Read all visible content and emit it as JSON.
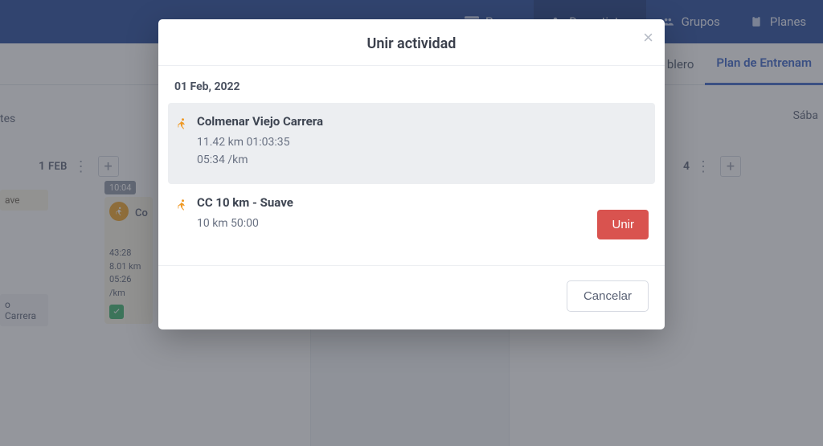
{
  "nav": {
    "items": [
      {
        "label": "Pagos",
        "icon": "pagos"
      },
      {
        "label": "Deportistas",
        "icon": "deportistas"
      },
      {
        "label": "Grupos",
        "icon": "grupos"
      },
      {
        "label": "Planes",
        "icon": "planes"
      }
    ],
    "active_index": 1
  },
  "subnav": {
    "items": [
      {
        "label": "blero"
      },
      {
        "label": "Plan de Entrenam"
      }
    ],
    "active_index": 1
  },
  "calendar": {
    "left_trunc_label": "tes",
    "right_trunc_label": "Sába",
    "day_feb1": {
      "num": "1",
      "month": "FEB"
    },
    "day_right": {
      "num": "4"
    },
    "bg_card1_title": "ave",
    "bg_card2_title": "o Carrera",
    "mini": {
      "time_badge": "10:04",
      "label_trunc": "Co",
      "line1": "43:28",
      "line2": "8.01 km",
      "line3": "05:26 /km"
    }
  },
  "modal": {
    "title": "Unir actividad",
    "date": "01 Feb, 2022",
    "activities": [
      {
        "title": "Colmenar Viejo Carrera",
        "line1": "11.42 km 01:03:35",
        "line2": "05:34 /km",
        "selected": true
      },
      {
        "title": "CC 10 km - Suave",
        "line1": "10 km 50:00",
        "line2": "",
        "selected": false
      }
    ],
    "join_label": "Unir",
    "cancel_label": "Cancelar"
  }
}
